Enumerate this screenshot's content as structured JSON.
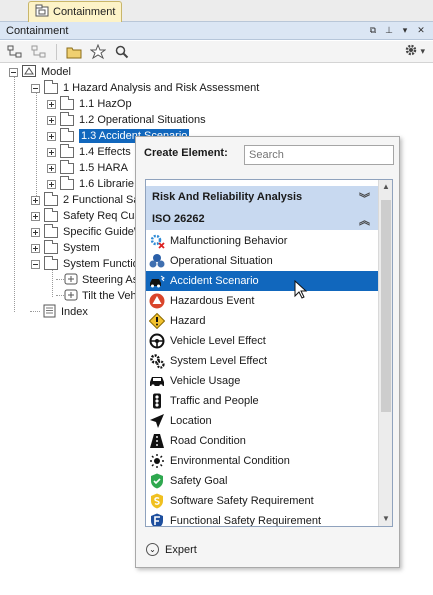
{
  "tab": {
    "label": "Containment"
  },
  "panel": {
    "title": "Containment"
  },
  "tree": {
    "model": "Model",
    "hazard_pkg": "1 Hazard Analysis and Risk Assessment",
    "hazop": "1.1 HazOp",
    "op_situations": "1.2 Operational Situations",
    "accident_scenario": "1.3 Accident Scenario",
    "effects": "1.4 Effects",
    "hara": "1.5 HARA",
    "libraries": "1.6 Librarie",
    "functional": "2 Functional Sa",
    "safety_req": "Safety Req Cus",
    "specific_guide": "Specific GuideW",
    "system": "System",
    "system_functions": "System Functio",
    "steering": "Steering As",
    "tilt": "Tilt the Veh",
    "index": "Index"
  },
  "popup": {
    "header": "Create Element:",
    "search_placeholder": "Search",
    "groups": [
      "Risk And Reliability Analysis",
      "ISO 26262"
    ],
    "items": [
      {
        "label": "Malfunctioning Behavior",
        "icon": "malfunction-gear-icon"
      },
      {
        "label": "Operational Situation",
        "icon": "operational-situation-icon"
      },
      {
        "label": "Accident Scenario",
        "icon": "car-crash-icon"
      },
      {
        "label": "Hazardous Event",
        "icon": "hazard-triangle-icon"
      },
      {
        "label": "Hazard",
        "icon": "warning-diamond-icon"
      },
      {
        "label": "Vehicle Level Effect",
        "icon": "steering-wheel-icon"
      },
      {
        "label": "System Level Effect",
        "icon": "gears-icon"
      },
      {
        "label": "Vehicle Usage",
        "icon": "car-icon"
      },
      {
        "label": "Traffic and People",
        "icon": "traffic-light-icon"
      },
      {
        "label": "Location",
        "icon": "location-arrow-icon"
      },
      {
        "label": "Road Condition",
        "icon": "road-icon"
      },
      {
        "label": "Environmental Condition",
        "icon": "sun-icon"
      },
      {
        "label": "Safety Goal",
        "icon": "green-shield-icon"
      },
      {
        "label": "Software Safety Requirement",
        "icon": "yellow-shield-icon"
      },
      {
        "label": "Functional Safety Requirement",
        "icon": "blue-shield-f-icon"
      }
    ],
    "expert": "Expert"
  },
  "colors": {
    "selection": "#1167bd",
    "group_bg": "#c8d9f0",
    "tab_bg": "#fdf3c8"
  }
}
